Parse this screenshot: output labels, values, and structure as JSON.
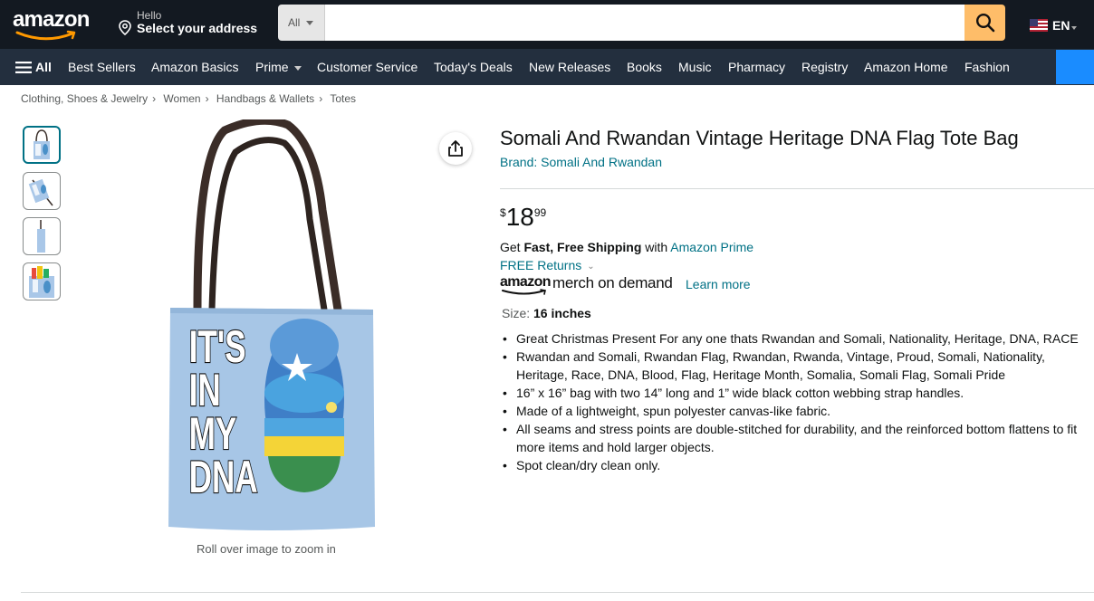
{
  "header": {
    "logo_text": "amazon",
    "deliver_hello": "Hello",
    "deliver_address": "Select your address",
    "search_category": "All",
    "search_placeholder": "",
    "language": "EN",
    "colors": {
      "nav_bg": "#131921",
      "subnav_bg": "#232f3e",
      "search_button": "#febd69"
    },
    "icons": [
      "location-pin-icon",
      "search-icon",
      "us-flag-icon"
    ]
  },
  "subnav": {
    "all_label": "All",
    "links": [
      "Best Sellers",
      "Amazon Basics",
      "Prime",
      "Customer Service",
      "Today's Deals",
      "New Releases",
      "Books",
      "Music",
      "Pharmacy",
      "Registry",
      "Amazon Home",
      "Fashion"
    ]
  },
  "breadcrumb": [
    "Clothing, Shoes & Jewelry",
    "Women",
    "Handbags & Wallets",
    "Totes"
  ],
  "gallery": {
    "zoom_hint": "Roll over image to zoom in",
    "bag_text": [
      "IT'S",
      "IN",
      "MY",
      "DNA"
    ],
    "thumbnail_count": 4,
    "active_thumbnail": 1
  },
  "product": {
    "title": "Somali And Rwandan Vintage Heritage DNA Flag Tote Bag",
    "brand_label": "Brand: Somali And Rwandan",
    "price_symbol": "$",
    "price_whole": "18",
    "price_fraction": "99",
    "shipping_get": "Get ",
    "shipping_fast": "Fast, Free Shipping",
    "shipping_with": " with ",
    "shipping_prime": "Amazon Prime",
    "returns_label": "FREE Returns",
    "merch_amazon": "amazon",
    "merch_rest": "merch on demand",
    "learn_more": "Learn more",
    "size_label": "Size: ",
    "size_value": "16 inches",
    "bullets": [
      "Great Christmas Present For any one thats Rwandan and Somali, Nationality, Heritage, DNA, RACE",
      "Rwandan and Somali, Rwandan Flag, Rwandan, Rwanda, Vintage, Proud, Somali, Nationality, Heritage, Race, DNA, Blood, Flag, Heritage Month, Somalia, Somali Flag, Somali Pride",
      "16” x 16” bag with two 14” long and 1” wide black cotton webbing strap handles.",
      "Made of a lightweight, spun polyester canvas-like fabric.",
      "All seams and stress points are double-stitched for durability, and the reinforced bottom flattens to fit more items and hold larger objects.",
      "Spot clean/dry clean only."
    ],
    "link_color": "#007185"
  }
}
